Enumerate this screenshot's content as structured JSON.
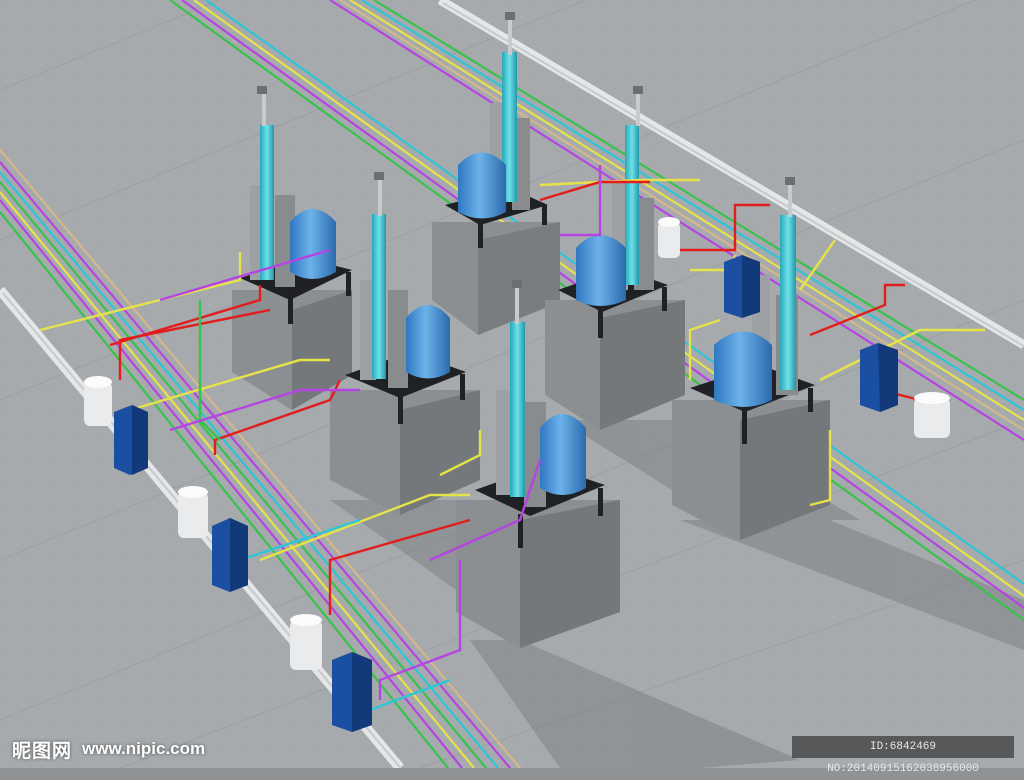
{
  "scene": {
    "subject": "3D rendering of six process units on concrete plinths with colored pipe racks on a rooftop",
    "colors": {
      "floor": "#a4a8ab",
      "concrete": "#8b8e90",
      "vessel": "#4d97d6",
      "column": "#3cc4d4",
      "frame": "#1f2124",
      "pump_box": "#1b4fa2",
      "pipe_colors": [
        "#e11d1d",
        "#e6e24a",
        "#b544e3",
        "#37c34b",
        "#2cc6d6",
        "#f0a3c4",
        "#d4b88b"
      ]
    }
  },
  "watermark": {
    "logo_text": "昵图网",
    "site": "www.nipic.com",
    "id_line": "ID:6842469 NO:20140915162038956000"
  }
}
